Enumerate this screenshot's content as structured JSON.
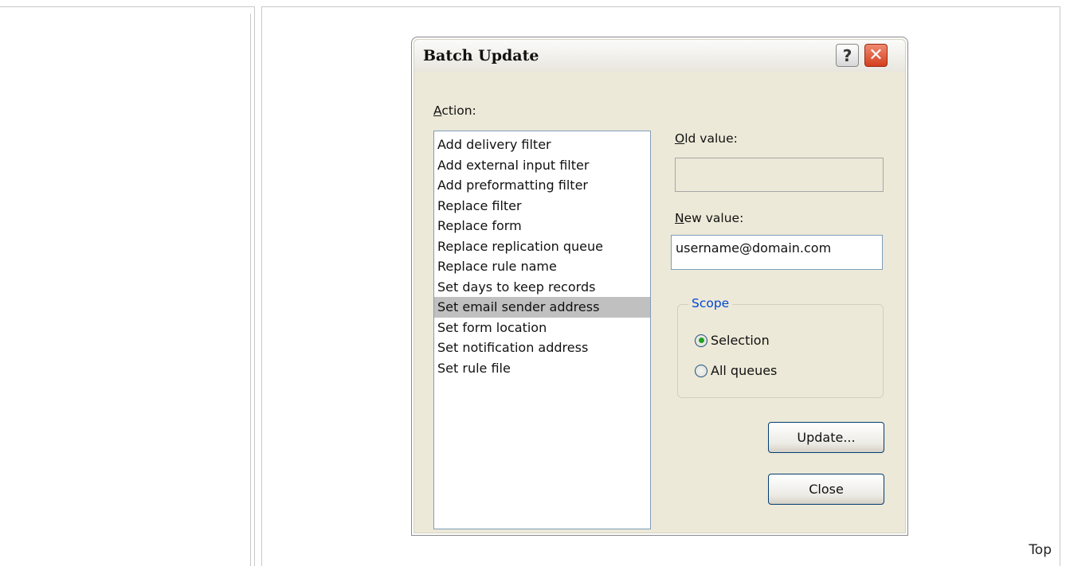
{
  "dialog": {
    "title": "Batch Update",
    "help_glyph": "?",
    "close_glyph": "✕",
    "action_label_accel": "A",
    "action_label_rest": "ction:",
    "actions": [
      "Add delivery filter",
      "Add external input filter",
      "Add preformatting filter",
      "Replace filter",
      "Replace form",
      "Replace replication queue",
      "Replace rule name",
      "Set days to keep records",
      "Set email sender address",
      "Set form location",
      "Set notification address",
      "Set rule file"
    ],
    "selected_action_index": 8,
    "old_value_accel": "O",
    "old_value_rest": "ld value:",
    "old_value": "",
    "new_value_accel": "N",
    "new_value_rest": "ew value:",
    "new_value": "username@domain.com",
    "scope": {
      "legend": "Scope",
      "options": [
        "Selection",
        "All queues"
      ],
      "selected": "Selection"
    },
    "update_button": "Update...",
    "close_button": "Close"
  },
  "page": {
    "top_link": "Top"
  },
  "colors": {
    "dialog_bg": "#ece9d8",
    "selection_bg": "#c0c0c0",
    "legend_text": "#0046d5",
    "close_button": "#d33f1e",
    "radio_dot": "#21a121"
  },
  "icons": {
    "help": "question-mark-icon",
    "close": "close-x-icon"
  }
}
